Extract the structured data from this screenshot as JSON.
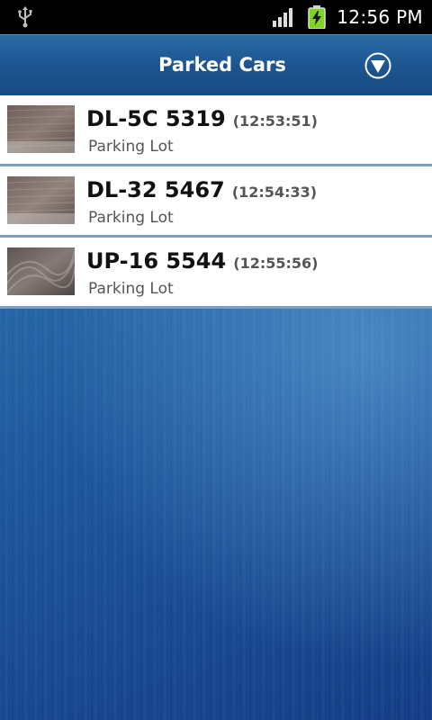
{
  "status_bar": {
    "clock": "12:56 PM",
    "icons": [
      "usb-icon",
      "signal-icon",
      "battery-charging-icon"
    ],
    "battery_color": "#7fd321"
  },
  "title_bar": {
    "title": "Parked Cars",
    "menu_icon": "down-arrow-circle-icon"
  },
  "cars": [
    {
      "plate": "DL-5C 5319",
      "time": "(12:53:51)",
      "location": "Parking Lot"
    },
    {
      "plate": "DL-32 5467",
      "time": "(12:54:33)",
      "location": "Parking Lot"
    },
    {
      "plate": "UP-16 5544",
      "time": "(12:55:56)",
      "location": "Parking Lot"
    }
  ]
}
